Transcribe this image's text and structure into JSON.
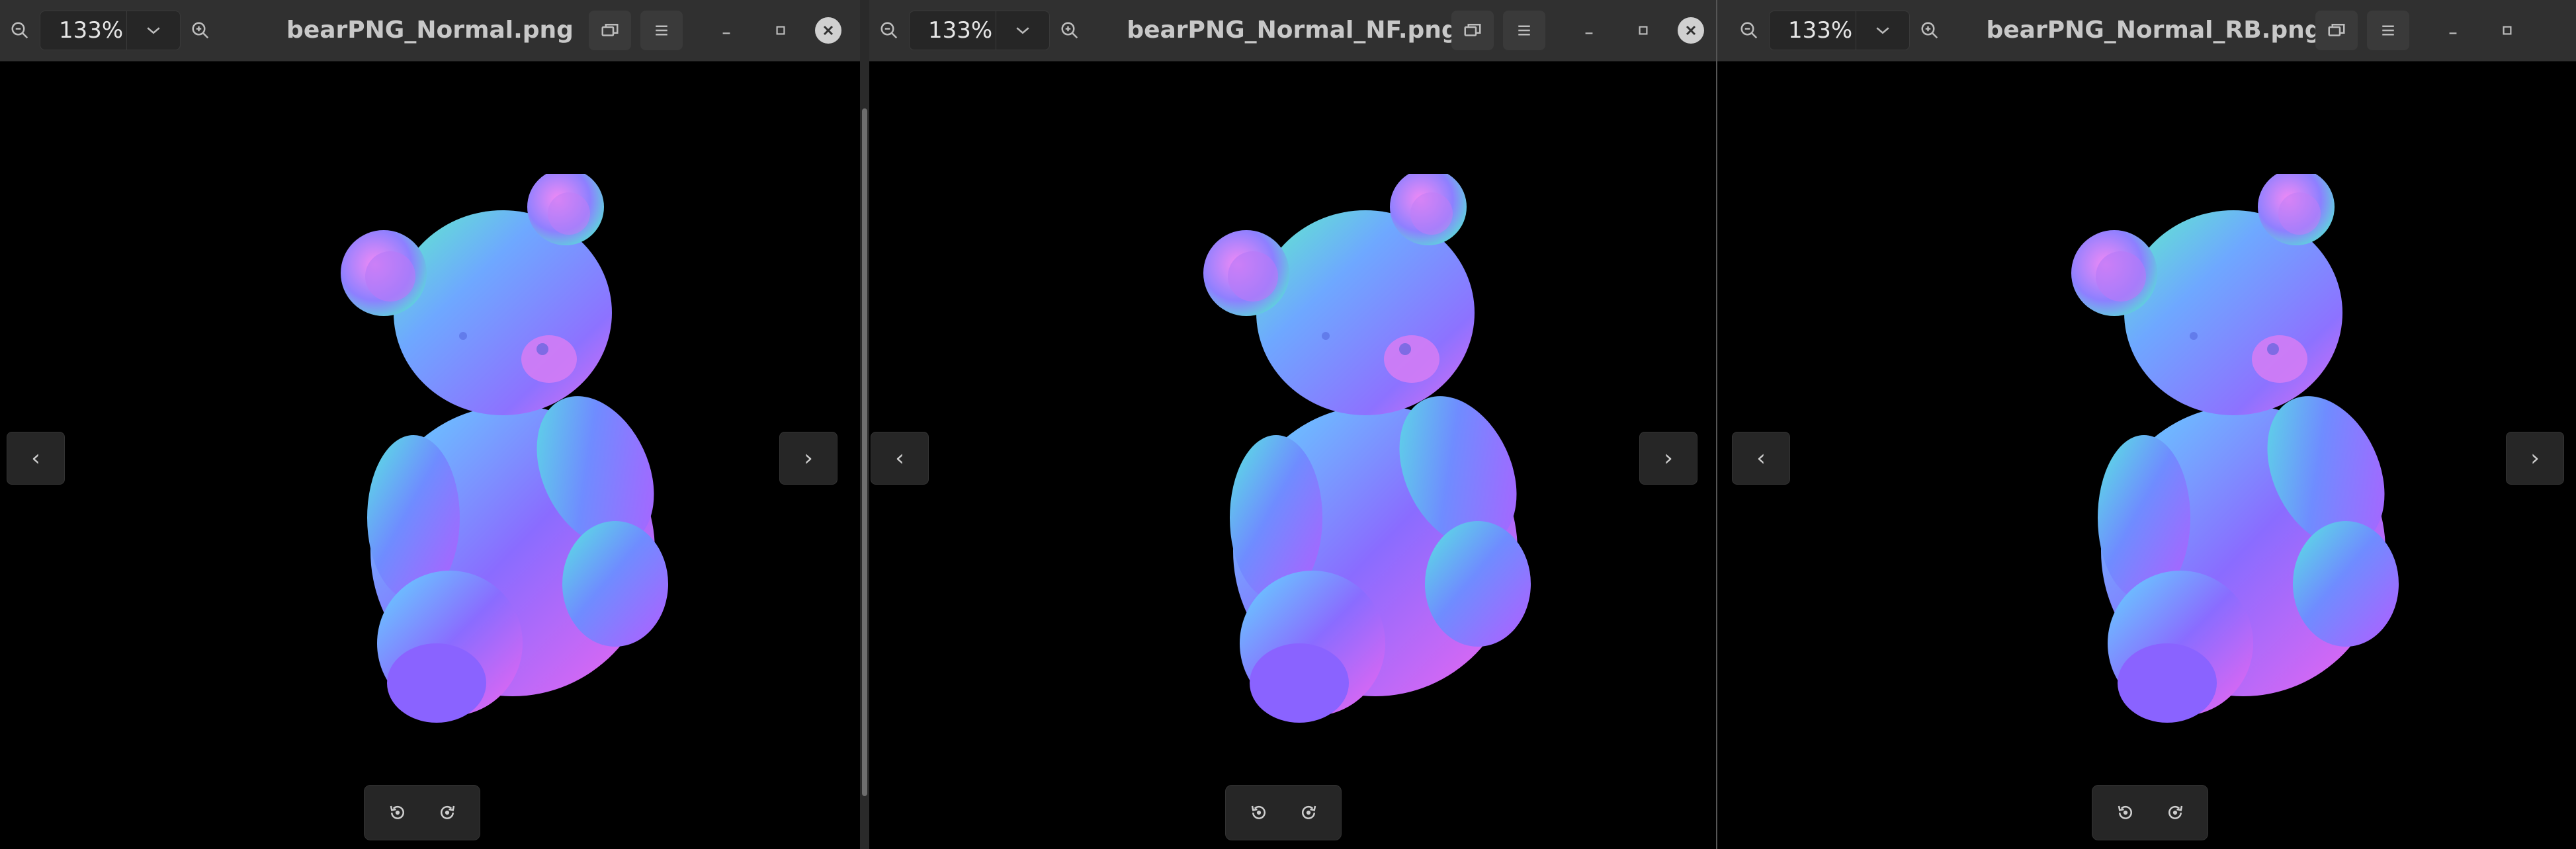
{
  "windows": [
    {
      "title": "bearPNG_Normal.png",
      "zoom": "133%",
      "icons": {
        "zoom_out": "zoom-out-icon",
        "zoom_in": "zoom-in-icon",
        "gallery": "gallery-icon",
        "menu": "hamburger-menu-icon",
        "minimize": "minimize-icon",
        "maximize": "maximize-icon",
        "close": "close-icon"
      },
      "nav": {
        "prev": "‹",
        "next": "›"
      }
    },
    {
      "title": "bearPNG_Normal_NF.png",
      "zoom": "133%",
      "nav": {
        "prev": "‹",
        "next": "›"
      }
    },
    {
      "title": "bearPNG_Normal_RB.png",
      "zoom": "133%",
      "nav": {
        "prev": "‹",
        "next": "›"
      }
    }
  ],
  "colors": {
    "titlebar": "#303030",
    "viewer_bg": "#000000",
    "bear_cyan": "#56e6d6",
    "bear_blue": "#6f8cff",
    "bear_violet": "#9a6cff",
    "bear_pink": "#e873ff"
  }
}
